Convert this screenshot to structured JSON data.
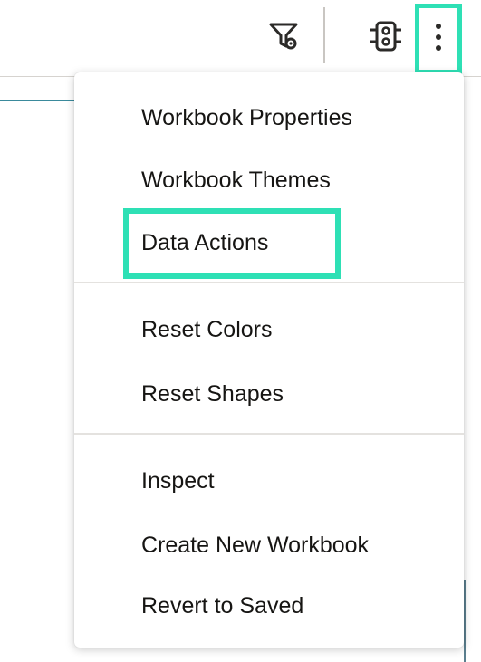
{
  "toolbar": {
    "filter_icon": "filter-settings-icon",
    "properties_icon": "properties-panel-icon",
    "more_icon": "more-vertical-icon"
  },
  "menu": {
    "groups": [
      {
        "items": [
          {
            "label": "Workbook Properties"
          },
          {
            "label": "Workbook Themes"
          },
          {
            "label": "Data Actions"
          }
        ]
      },
      {
        "items": [
          {
            "label": "Reset Colors"
          },
          {
            "label": "Reset Shapes"
          }
        ]
      },
      {
        "items": [
          {
            "label": "Inspect"
          },
          {
            "label": "Create New Workbook"
          },
          {
            "label": "Revert to Saved"
          }
        ]
      }
    ]
  },
  "colors": {
    "highlight": "#2ee0b5",
    "text": "#161513",
    "icon": "#2b2a28"
  }
}
